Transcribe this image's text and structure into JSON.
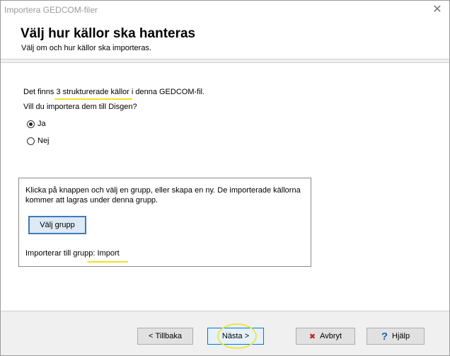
{
  "window": {
    "title": "Importera GEDCOM-filer",
    "close_glyph": "✕"
  },
  "header": {
    "title": "Välj hur källor ska hanteras",
    "subtitle": "Välj om och hur källor ska importeras."
  },
  "content": {
    "intro_before": "Det finns ",
    "intro_highlight": "3 strukturerade källor",
    "intro_after": " i denna GEDCOM-fil.",
    "question": "Vill du importera dem till Disgen?",
    "options": [
      {
        "label": "Ja",
        "checked": true
      },
      {
        "label": "Nej",
        "checked": false
      }
    ],
    "group": {
      "info_line1": "Klicka på knappen och välj en grupp, eller skapa en ny. De importerade källorna",
      "info_line2": "kommer att lagras under denna grupp.",
      "select_button": "Välj grupp",
      "import_label": "Importerar till grupp: ",
      "import_value": "Import"
    }
  },
  "footer": {
    "back": {
      "arrow": "<",
      "label": "Tillbaka"
    },
    "next": {
      "label": "Nästa",
      "arrow": ">"
    },
    "cancel": {
      "icon": "✖",
      "label": "Avbryt"
    },
    "help": {
      "icon": "?",
      "label": "Hjälp"
    }
  },
  "colors": {
    "highlight": "#f6e020",
    "cancel_icon": "#c0241b",
    "help_icon": "#1f5fb0"
  }
}
